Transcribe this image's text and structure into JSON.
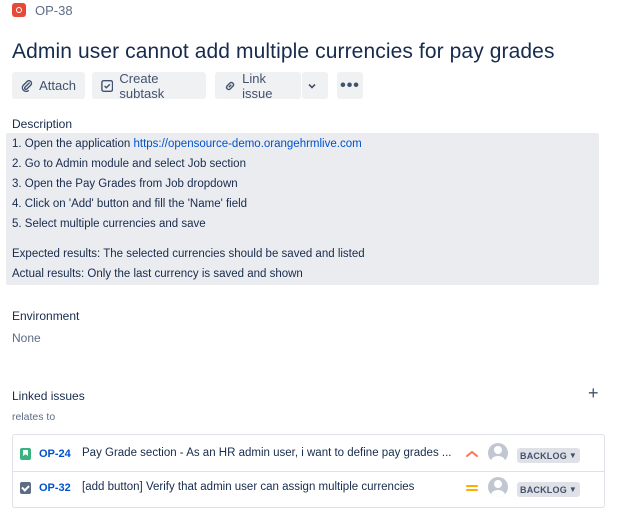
{
  "breadcrumb": {
    "issue_key": "OP-38",
    "issue_type_icon": "bug-icon"
  },
  "issue": {
    "title": "Admin user cannot add multiple currencies for pay grades"
  },
  "toolbar": {
    "attach_label": "Attach",
    "create_subtask_label": "Create subtask",
    "link_issue_label": "Link issue",
    "more_label": "•••"
  },
  "description": {
    "label": "Description",
    "step1_text": "1. Open the application ",
    "step1_link": "https://opensource-demo.orangehrmlive.com",
    "step2": "2. Go to Admin module and select Job section",
    "step3": "3. Open the Pay Grades from Job dropdown",
    "step4": "4. Click on 'Add' button and fill the 'Name' field",
    "step5": "5. Select multiple currencies and save",
    "expected": "Expected results: The selected currencies should be saved and listed",
    "actual": "Actual results: Only the last currency is saved and shown"
  },
  "environment": {
    "label": "Environment",
    "value": "None"
  },
  "linked_issues": {
    "label": "Linked issues",
    "add_label": "+",
    "relation": "relates to",
    "items": [
      {
        "key": "OP-24",
        "summary": "Pay Grade section - As an HR admin user, i want to define pay grades ...",
        "type": "story",
        "priority": "high",
        "status": "BACKLOG"
      },
      {
        "key": "OP-32",
        "summary": "[add button] Verify that admin user can assign multiple currencies",
        "type": "task",
        "priority": "medium",
        "status": "BACKLOG"
      }
    ]
  },
  "colors": {
    "link": "#0052cc",
    "text": "#172b4d",
    "description_bg": "#ebecf0",
    "priority_high": "#ff7452",
    "priority_medium": "#ffab00"
  }
}
